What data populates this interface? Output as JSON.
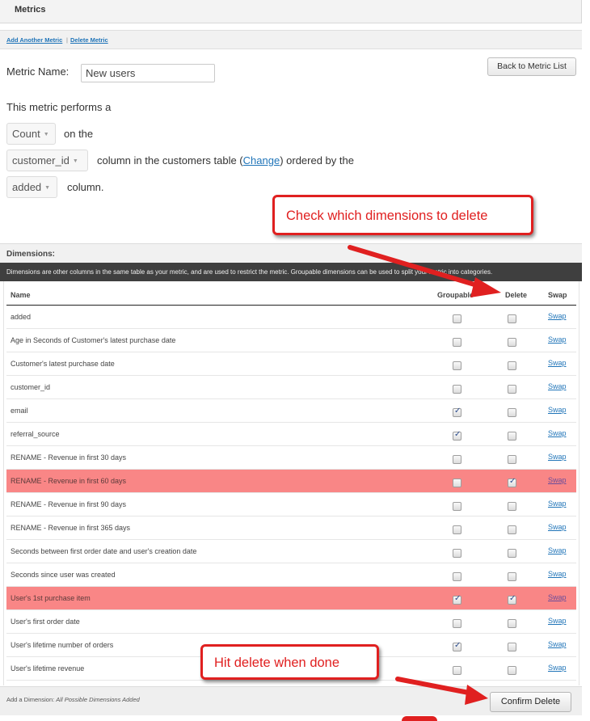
{
  "header": {
    "title": "Metrics"
  },
  "links": {
    "add_metric": "Add Another Metric",
    "separator": "|",
    "delete_metric": "Delete Metric"
  },
  "metric": {
    "name_label": "Metric Name:",
    "name_value": "New users",
    "back_button": "Back to Metric List",
    "performs_text": "This metric performs a",
    "aggregate": "Count",
    "on_the": "on the",
    "column": "customer_id",
    "column_text_before": "column in the customers table (",
    "change_link": "Change",
    "column_text_after": ") ordered by the",
    "order_column": "added",
    "order_text": "column."
  },
  "callouts": {
    "top": "Check which dimensions to delete",
    "bottom": "Hit delete when done"
  },
  "dimensions": {
    "title": "Dimensions:",
    "description": "Dimensions are other columns in the same table as your metric, and are used to restrict the metric. Groupable dimensions can be used to split your metric into categories.",
    "columns": {
      "name": "Name",
      "groupable": "Groupable",
      "delete": "Delete",
      "swap": "Swap"
    },
    "rows": [
      {
        "name": "added",
        "groupable": false,
        "delete": false,
        "highlight": false,
        "swap": "Swap"
      },
      {
        "name": "Age in Seconds of Customer's latest purchase date",
        "groupable": false,
        "delete": false,
        "highlight": false,
        "swap": "Swap"
      },
      {
        "name": "Customer's latest purchase date",
        "groupable": false,
        "delete": false,
        "highlight": false,
        "swap": "Swap"
      },
      {
        "name": "customer_id",
        "groupable": false,
        "delete": false,
        "highlight": false,
        "swap": "Swap"
      },
      {
        "name": "email",
        "groupable": true,
        "delete": false,
        "highlight": false,
        "swap": "Swap"
      },
      {
        "name": "referral_source",
        "groupable": true,
        "delete": false,
        "highlight": false,
        "swap": "Swap"
      },
      {
        "name": "RENAME - Revenue in first 30 days",
        "groupable": false,
        "delete": false,
        "highlight": false,
        "swap": "Swap"
      },
      {
        "name": "RENAME - Revenue in first 60 days",
        "groupable": false,
        "delete": true,
        "highlight": true,
        "swap": "Swap"
      },
      {
        "name": "RENAME - Revenue in first 90 days",
        "groupable": false,
        "delete": false,
        "highlight": false,
        "swap": "Swap"
      },
      {
        "name": "RENAME - Revenue in first 365 days",
        "groupable": false,
        "delete": false,
        "highlight": false,
        "swap": "Swap"
      },
      {
        "name": "Seconds between first order date and user's creation date",
        "groupable": false,
        "delete": false,
        "highlight": false,
        "swap": "Swap"
      },
      {
        "name": "Seconds since user was created",
        "groupable": false,
        "delete": false,
        "highlight": false,
        "swap": "Swap"
      },
      {
        "name": "User's 1st purchase item",
        "groupable": true,
        "delete": true,
        "highlight": true,
        "swap": "Swap"
      },
      {
        "name": "User's first order date",
        "groupable": false,
        "delete": false,
        "highlight": false,
        "swap": "Swap"
      },
      {
        "name": "User's lifetime number of orders",
        "groupable": true,
        "delete": false,
        "highlight": false,
        "swap": "Swap"
      },
      {
        "name": "User's lifetime revenue",
        "groupable": false,
        "delete": false,
        "highlight": false,
        "swap": "Swap"
      }
    ]
  },
  "footer": {
    "add_label": "Add a Dimension:",
    "add_status": "All Possible Dimensions Added",
    "confirm_button": "Confirm Delete"
  },
  "colors": {
    "annotation": "#e02020",
    "highlight_row": "#f98686",
    "link": "#1f74b8"
  }
}
